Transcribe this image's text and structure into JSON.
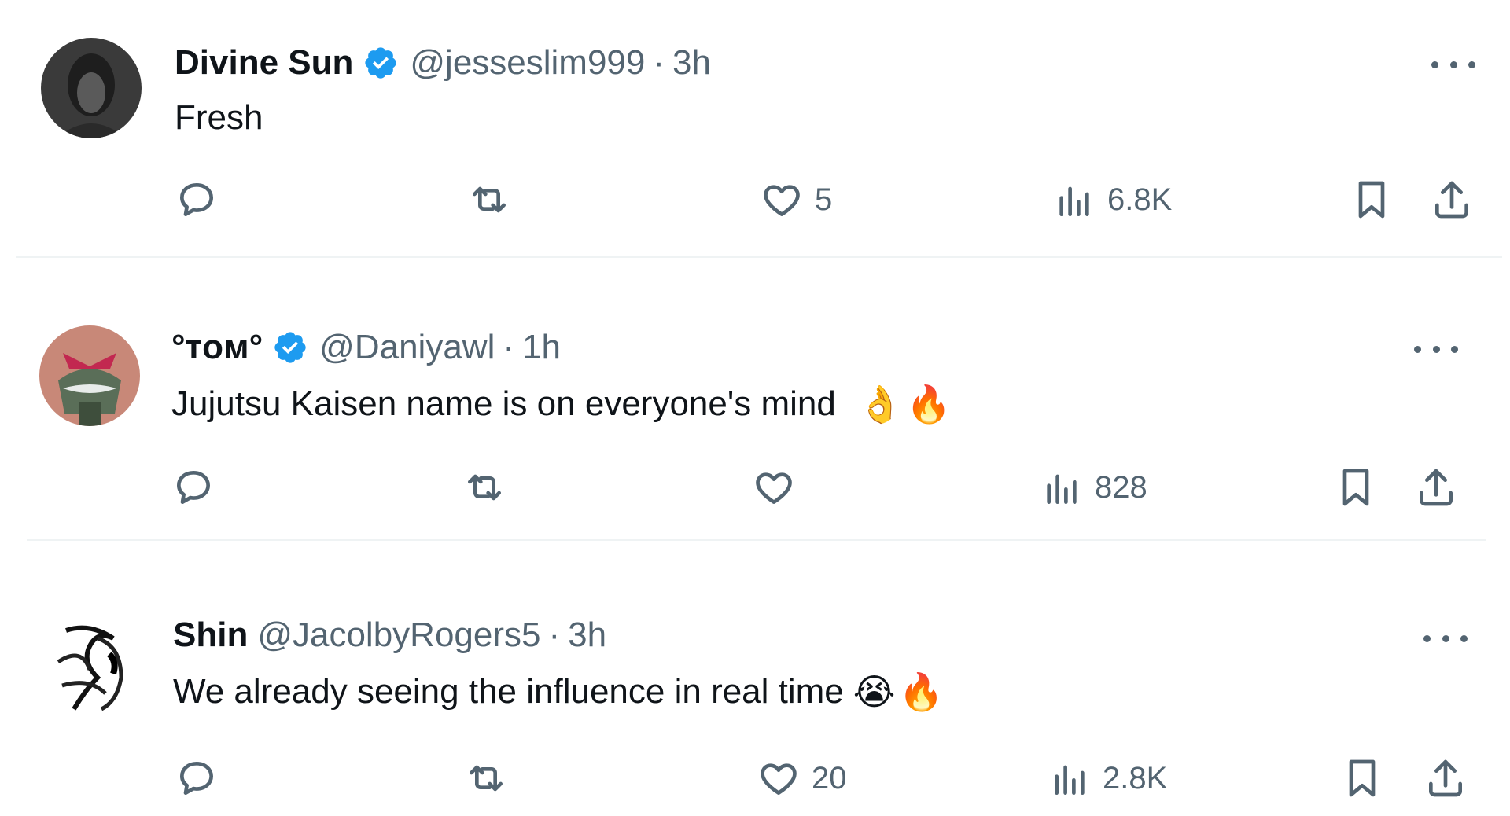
{
  "tweets": [
    {
      "name": "Divine Sun",
      "verified": true,
      "handle": "@jesseslim999",
      "separator": "·",
      "time": "3h",
      "text": "Fresh",
      "emojis": [],
      "reply_count": "",
      "retweet_count": "",
      "like_count": "5",
      "views": "6.8K",
      "avatar": "dark-portrait-avatar"
    },
    {
      "name": "°ᴛᴏᴍ°",
      "verified": true,
      "handle": "@Daniyawl",
      "separator": "·",
      "time": "1h",
      "text": "Jujutsu Kaisen name is on everyone's mind",
      "emojis": [
        "👌",
        "🔥"
      ],
      "reply_count": "",
      "retweet_count": "",
      "like_count": "",
      "views": "828",
      "avatar": "anime-character-avatar"
    },
    {
      "name": "Shin",
      "verified": false,
      "handle": "@JacolbyRogers5",
      "separator": "·",
      "time": "3h",
      "text": "We already seeing the influence in real time",
      "emojis": [
        "😭",
        "🔥"
      ],
      "reply_count": "",
      "retweet_count": "",
      "like_count": "20",
      "views": "2.8K",
      "avatar": "sketch-character-avatar"
    }
  ],
  "colors": {
    "text": "#0f1419",
    "muted": "#536471",
    "verified": "#1d9bf0",
    "divider": "#eff3f4"
  }
}
